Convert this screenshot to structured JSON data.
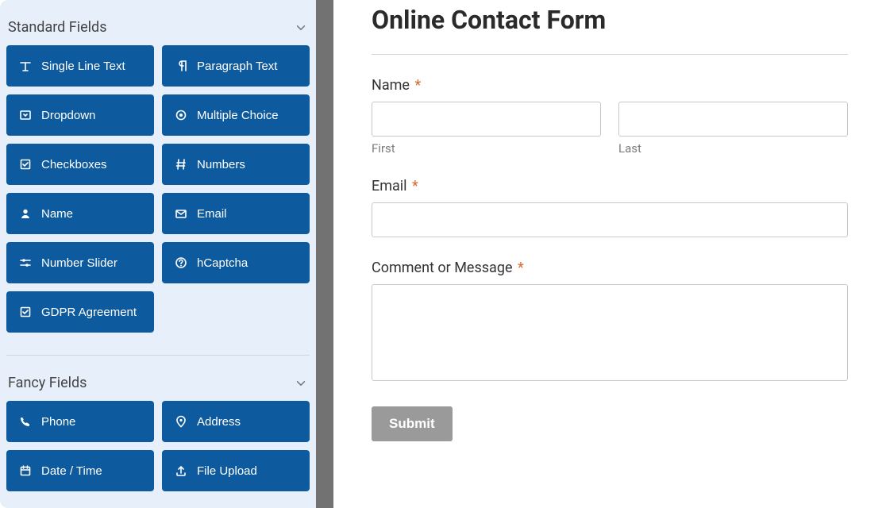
{
  "sidebar": {
    "standard": {
      "title": "Standard Fields",
      "items": [
        {
          "label": "Single Line Text",
          "icon": "text-icon"
        },
        {
          "label": "Paragraph Text",
          "icon": "paragraph-icon"
        },
        {
          "label": "Dropdown",
          "icon": "dropdown-icon"
        },
        {
          "label": "Multiple Choice",
          "icon": "radio-icon"
        },
        {
          "label": "Checkboxes",
          "icon": "checkbox-icon"
        },
        {
          "label": "Numbers",
          "icon": "hash-icon"
        },
        {
          "label": "Name",
          "icon": "user-icon"
        },
        {
          "label": "Email",
          "icon": "envelope-icon"
        },
        {
          "label": "Number Slider",
          "icon": "slider-icon"
        },
        {
          "label": "hCaptcha",
          "icon": "question-icon"
        },
        {
          "label": "GDPR Agreement",
          "icon": "checkbox-icon"
        }
      ]
    },
    "fancy": {
      "title": "Fancy Fields",
      "items": [
        {
          "label": "Phone",
          "icon": "phone-icon"
        },
        {
          "label": "Address",
          "icon": "pin-icon"
        },
        {
          "label": "Date / Time",
          "icon": "calendar-icon"
        },
        {
          "label": "File Upload",
          "icon": "upload-icon"
        }
      ]
    }
  },
  "form": {
    "title": "Online Contact Form",
    "name_label": "Name",
    "first_sub": "First",
    "last_sub": "Last",
    "email_label": "Email",
    "message_label": "Comment or Message",
    "submit_label": "Submit",
    "required_mark": "*"
  }
}
